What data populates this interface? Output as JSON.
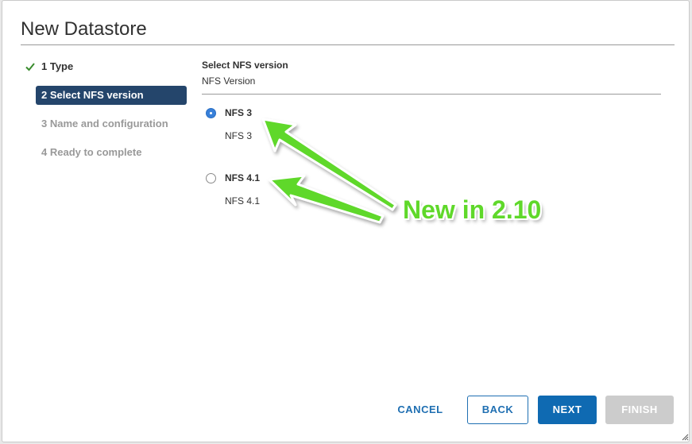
{
  "dialog": {
    "title": "New Datastore"
  },
  "steps": [
    {
      "label": "1 Type",
      "state": "done"
    },
    {
      "label": "2 Select NFS version",
      "state": "active"
    },
    {
      "label": "3 Name and configuration",
      "state": "pending"
    },
    {
      "label": "4 Ready to complete",
      "state": "pending"
    }
  ],
  "content": {
    "section_title": "Select NFS version",
    "section_subtitle": "NFS Version",
    "options": [
      {
        "label": "NFS 3",
        "description": "NFS 3",
        "selected": true
      },
      {
        "label": "NFS 4.1",
        "description": "NFS 4.1",
        "selected": false
      }
    ]
  },
  "annotation": {
    "text": "New in 2.10",
    "color": "#5fd82a"
  },
  "footer": {
    "cancel_label": "CANCEL",
    "back_label": "BACK",
    "next_label": "NEXT",
    "finish_label": "FINISH"
  },
  "colors": {
    "active_step_bg": "#24456b",
    "primary": "#0f6ab2",
    "link": "#1f6fb2",
    "disabled": "#cccccc",
    "check": "#3a8c2e"
  },
  "icons": {
    "step_done": "check-icon",
    "resize": "resize-grip-icon"
  }
}
